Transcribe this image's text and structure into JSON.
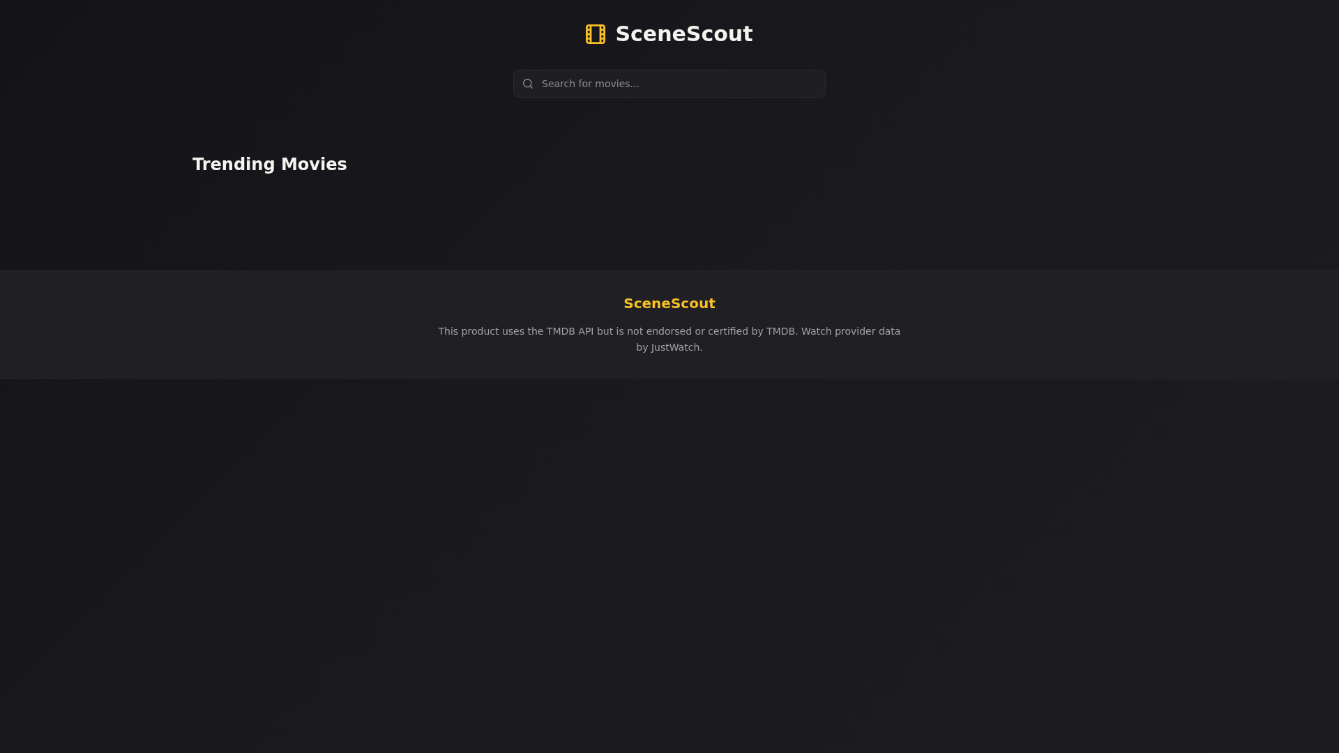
{
  "header": {
    "title": "SceneScout",
    "search": {
      "placeholder": "Search for movies..."
    }
  },
  "main": {
    "heading": "Trending Movies"
  },
  "footer": {
    "title": "SceneScout",
    "note": "This product uses the TMDB API but is not endorsed or certified by TMDB. Watch provider data by JustWatch."
  }
}
